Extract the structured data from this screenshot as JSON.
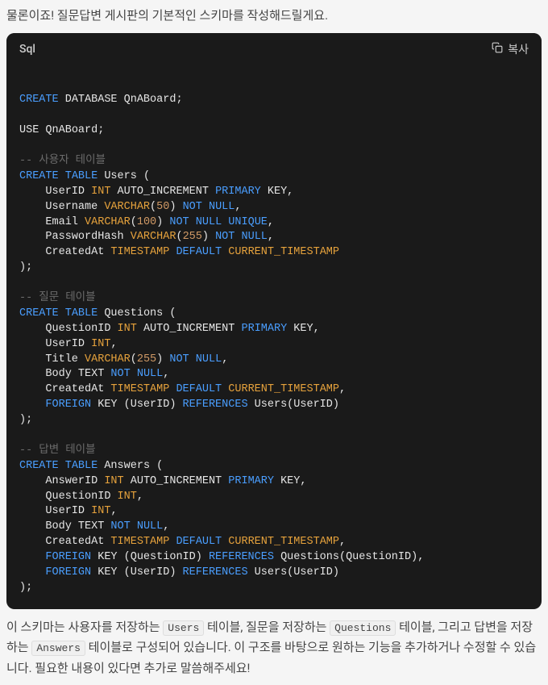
{
  "intro": "물론이죠! 질문답변 게시판의 기본적인 스키마를 작성해드릴게요.",
  "code_header": {
    "language": "Sql",
    "copy_label": "복사"
  },
  "code": {
    "tokens": [
      {
        "t": "\n",
        "c": ""
      },
      {
        "t": "CREATE",
        "c": "kw"
      },
      {
        "t": " ",
        "c": ""
      },
      {
        "t": "DATABASE",
        "c": "ident"
      },
      {
        "t": " QnABoard;\n\n",
        "c": ""
      },
      {
        "t": "USE",
        "c": "ident"
      },
      {
        "t": " QnABoard;\n\n",
        "c": ""
      },
      {
        "t": "-- 사용자 테이블\n",
        "c": "cmt"
      },
      {
        "t": "CREATE",
        "c": "kw"
      },
      {
        "t": " ",
        "c": ""
      },
      {
        "t": "TABLE",
        "c": "kw"
      },
      {
        "t": " Users (\n",
        "c": ""
      },
      {
        "t": "    UserID ",
        "c": ""
      },
      {
        "t": "INT",
        "c": "type"
      },
      {
        "t": " AUTO_INCREMENT ",
        "c": ""
      },
      {
        "t": "PRIMARY",
        "c": "kw"
      },
      {
        "t": " KEY,\n",
        "c": ""
      },
      {
        "t": "    Username ",
        "c": ""
      },
      {
        "t": "VARCHAR",
        "c": "type"
      },
      {
        "t": "(",
        "c": ""
      },
      {
        "t": "50",
        "c": "num"
      },
      {
        "t": ") ",
        "c": ""
      },
      {
        "t": "NOT",
        "c": "kw"
      },
      {
        "t": " ",
        "c": ""
      },
      {
        "t": "NULL",
        "c": "kw"
      },
      {
        "t": ",\n",
        "c": ""
      },
      {
        "t": "    Email ",
        "c": ""
      },
      {
        "t": "VARCHAR",
        "c": "type"
      },
      {
        "t": "(",
        "c": ""
      },
      {
        "t": "100",
        "c": "num"
      },
      {
        "t": ") ",
        "c": ""
      },
      {
        "t": "NOT",
        "c": "kw"
      },
      {
        "t": " ",
        "c": ""
      },
      {
        "t": "NULL",
        "c": "kw"
      },
      {
        "t": " ",
        "c": ""
      },
      {
        "t": "UNIQUE",
        "c": "kw"
      },
      {
        "t": ",\n",
        "c": ""
      },
      {
        "t": "    PasswordHash ",
        "c": ""
      },
      {
        "t": "VARCHAR",
        "c": "type"
      },
      {
        "t": "(",
        "c": ""
      },
      {
        "t": "255",
        "c": "num"
      },
      {
        "t": ") ",
        "c": ""
      },
      {
        "t": "NOT",
        "c": "kw"
      },
      {
        "t": " ",
        "c": ""
      },
      {
        "t": "NULL",
        "c": "kw"
      },
      {
        "t": ",\n",
        "c": ""
      },
      {
        "t": "    CreatedAt ",
        "c": ""
      },
      {
        "t": "TIMESTAMP",
        "c": "type"
      },
      {
        "t": " ",
        "c": ""
      },
      {
        "t": "DEFAULT",
        "c": "kw"
      },
      {
        "t": " ",
        "c": ""
      },
      {
        "t": "CURRENT_TIMESTAMP",
        "c": "fn"
      },
      {
        "t": "\n",
        "c": ""
      },
      {
        "t": ");\n\n",
        "c": ""
      },
      {
        "t": "-- 질문 테이블\n",
        "c": "cmt"
      },
      {
        "t": "CREATE",
        "c": "kw"
      },
      {
        "t": " ",
        "c": ""
      },
      {
        "t": "TABLE",
        "c": "kw"
      },
      {
        "t": " Questions (\n",
        "c": ""
      },
      {
        "t": "    QuestionID ",
        "c": ""
      },
      {
        "t": "INT",
        "c": "type"
      },
      {
        "t": " AUTO_INCREMENT ",
        "c": ""
      },
      {
        "t": "PRIMARY",
        "c": "kw"
      },
      {
        "t": " KEY,\n",
        "c": ""
      },
      {
        "t": "    UserID ",
        "c": ""
      },
      {
        "t": "INT",
        "c": "type"
      },
      {
        "t": ",\n",
        "c": ""
      },
      {
        "t": "    Title ",
        "c": ""
      },
      {
        "t": "VARCHAR",
        "c": "type"
      },
      {
        "t": "(",
        "c": ""
      },
      {
        "t": "255",
        "c": "num"
      },
      {
        "t": ") ",
        "c": ""
      },
      {
        "t": "NOT",
        "c": "kw"
      },
      {
        "t": " ",
        "c": ""
      },
      {
        "t": "NULL",
        "c": "kw"
      },
      {
        "t": ",\n",
        "c": ""
      },
      {
        "t": "    Body TEXT ",
        "c": ""
      },
      {
        "t": "NOT",
        "c": "kw"
      },
      {
        "t": " ",
        "c": ""
      },
      {
        "t": "NULL",
        "c": "kw"
      },
      {
        "t": ",\n",
        "c": ""
      },
      {
        "t": "    CreatedAt ",
        "c": ""
      },
      {
        "t": "TIMESTAMP",
        "c": "type"
      },
      {
        "t": " ",
        "c": ""
      },
      {
        "t": "DEFAULT",
        "c": "kw"
      },
      {
        "t": " ",
        "c": ""
      },
      {
        "t": "CURRENT_TIMESTAMP",
        "c": "fn"
      },
      {
        "t": ",\n",
        "c": ""
      },
      {
        "t": "    ",
        "c": ""
      },
      {
        "t": "FOREIGN",
        "c": "kw"
      },
      {
        "t": " KEY (UserID) ",
        "c": ""
      },
      {
        "t": "REFERENCES",
        "c": "kw"
      },
      {
        "t": " Users(UserID)\n",
        "c": ""
      },
      {
        "t": ");\n\n",
        "c": ""
      },
      {
        "t": "-- 답변 테이블\n",
        "c": "cmt"
      },
      {
        "t": "CREATE",
        "c": "kw"
      },
      {
        "t": " ",
        "c": ""
      },
      {
        "t": "TABLE",
        "c": "kw"
      },
      {
        "t": " Answers (\n",
        "c": ""
      },
      {
        "t": "    AnswerID ",
        "c": ""
      },
      {
        "t": "INT",
        "c": "type"
      },
      {
        "t": " AUTO_INCREMENT ",
        "c": ""
      },
      {
        "t": "PRIMARY",
        "c": "kw"
      },
      {
        "t": " KEY,\n",
        "c": ""
      },
      {
        "t": "    QuestionID ",
        "c": ""
      },
      {
        "t": "INT",
        "c": "type"
      },
      {
        "t": ",\n",
        "c": ""
      },
      {
        "t": "    UserID ",
        "c": ""
      },
      {
        "t": "INT",
        "c": "type"
      },
      {
        "t": ",\n",
        "c": ""
      },
      {
        "t": "    Body TEXT ",
        "c": ""
      },
      {
        "t": "NOT",
        "c": "kw"
      },
      {
        "t": " ",
        "c": ""
      },
      {
        "t": "NULL",
        "c": "kw"
      },
      {
        "t": ",\n",
        "c": ""
      },
      {
        "t": "    CreatedAt ",
        "c": ""
      },
      {
        "t": "TIMESTAMP",
        "c": "type"
      },
      {
        "t": " ",
        "c": ""
      },
      {
        "t": "DEFAULT",
        "c": "kw"
      },
      {
        "t": " ",
        "c": ""
      },
      {
        "t": "CURRENT_TIMESTAMP",
        "c": "fn"
      },
      {
        "t": ",\n",
        "c": ""
      },
      {
        "t": "    ",
        "c": ""
      },
      {
        "t": "FOREIGN",
        "c": "kw"
      },
      {
        "t": " KEY (QuestionID) ",
        "c": ""
      },
      {
        "t": "REFERENCES",
        "c": "kw"
      },
      {
        "t": " Questions(QuestionID),\n",
        "c": ""
      },
      {
        "t": "    ",
        "c": ""
      },
      {
        "t": "FOREIGN",
        "c": "kw"
      },
      {
        "t": " KEY (UserID) ",
        "c": ""
      },
      {
        "t": "REFERENCES",
        "c": "kw"
      },
      {
        "t": " Users(UserID)\n",
        "c": ""
      },
      {
        "t": ");\n",
        "c": ""
      }
    ]
  },
  "outro": {
    "parts": [
      {
        "text": "이 스키마는 사용자를 저장하는 ",
        "code": false
      },
      {
        "text": "Users",
        "code": true
      },
      {
        "text": " 테이블, 질문을 저장하는 ",
        "code": false
      },
      {
        "text": "Questions",
        "code": true
      },
      {
        "text": " 테이블, 그리고 답변을 저장하는 ",
        "code": false
      },
      {
        "text": "Answers",
        "code": true
      },
      {
        "text": " 테이블로 구성되어 있습니다. 이 구조를 바탕으로 원하는 기능을 추가하거나 수정할 수 있습니다. 필요한 내용이 있다면 추가로 말씀해주세요!",
        "code": false
      }
    ]
  }
}
